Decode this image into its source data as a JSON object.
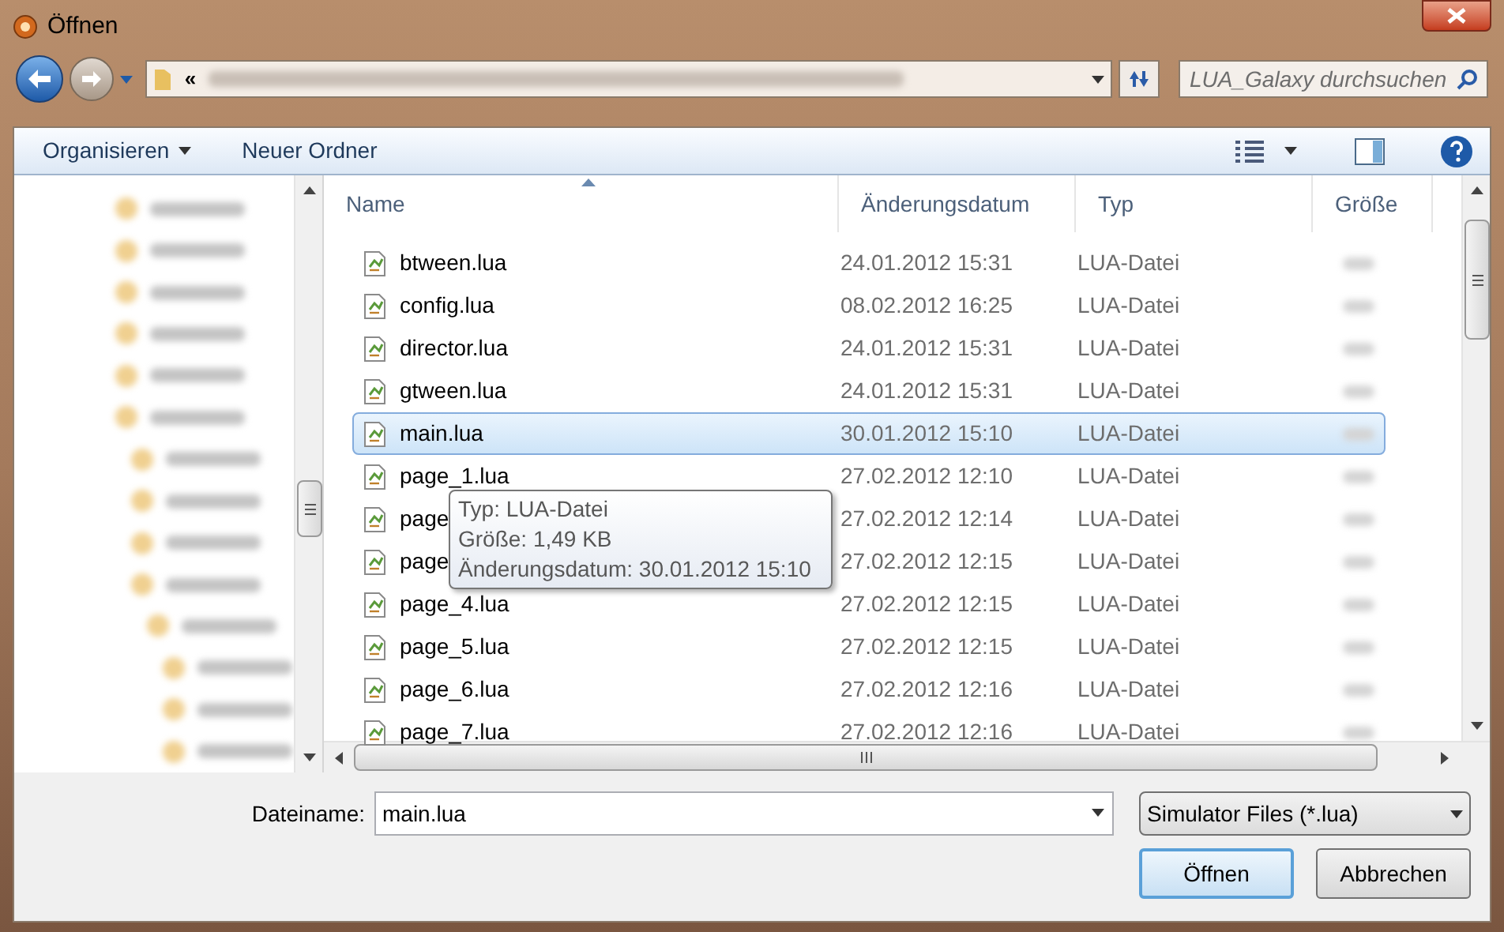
{
  "window": {
    "title": "Öffnen"
  },
  "address_bar": {
    "overflow": "«"
  },
  "search": {
    "placeholder": "LUA_Galaxy durchsuchen"
  },
  "toolbar": [
    {
      "label": "Organisieren",
      "kind": "menu"
    },
    {
      "label": "Neuer Ordner",
      "kind": "button"
    }
  ],
  "columns": [
    {
      "label": "Name",
      "sorted": true
    },
    {
      "label": "Änderungsdatum",
      "sorted": false
    },
    {
      "label": "Typ",
      "sorted": false
    },
    {
      "label": "Größe",
      "sorted": false
    }
  ],
  "files": [
    {
      "name": "btween.lua",
      "modified": "24.01.2012 15:31",
      "type": "LUA-Datei",
      "selected": false
    },
    {
      "name": "config.lua",
      "modified": "08.02.2012 16:25",
      "type": "LUA-Datei",
      "selected": false
    },
    {
      "name": "director.lua",
      "modified": "24.01.2012 15:31",
      "type": "LUA-Datei",
      "selected": false
    },
    {
      "name": "gtween.lua",
      "modified": "24.01.2012 15:31",
      "type": "LUA-Datei",
      "selected": false
    },
    {
      "name": "main.lua",
      "modified": "30.01.2012 15:10",
      "type": "LUA-Datei",
      "selected": true
    },
    {
      "name": "page_1.lua",
      "modified": "27.02.2012 12:10",
      "type": "LUA-Datei",
      "selected": false
    },
    {
      "name": "page",
      "modified": "27.02.2012 12:14",
      "type": "LUA-Datei",
      "selected": false
    },
    {
      "name": "page",
      "modified": "27.02.2012 12:15",
      "type": "LUA-Datei",
      "selected": false
    },
    {
      "name": "page_4.lua",
      "modified": "27.02.2012 12:15",
      "type": "LUA-Datei",
      "selected": false
    },
    {
      "name": "page_5.lua",
      "modified": "27.02.2012 12:15",
      "type": "LUA-Datei",
      "selected": false
    },
    {
      "name": "page_6.lua",
      "modified": "27.02.2012 12:16",
      "type": "LUA-Datei",
      "selected": false
    },
    {
      "name": "page_7.lua",
      "modified": "27.02.2012 12:16",
      "type": "LUA-Datei",
      "selected": false
    }
  ],
  "tooltip": {
    "lines": [
      "Typ: LUA-Datei",
      "Größe: 1,49 KB",
      "Änderungsdatum: 30.01.2012 15:10"
    ]
  },
  "filename": {
    "label": "Dateiname:",
    "value": "main.lua"
  },
  "filetype": {
    "value": "Simulator Files (*.lua)"
  },
  "buttons": [
    {
      "label": "Öffnen",
      "default": true
    },
    {
      "label": "Abbrechen",
      "default": false
    }
  ]
}
